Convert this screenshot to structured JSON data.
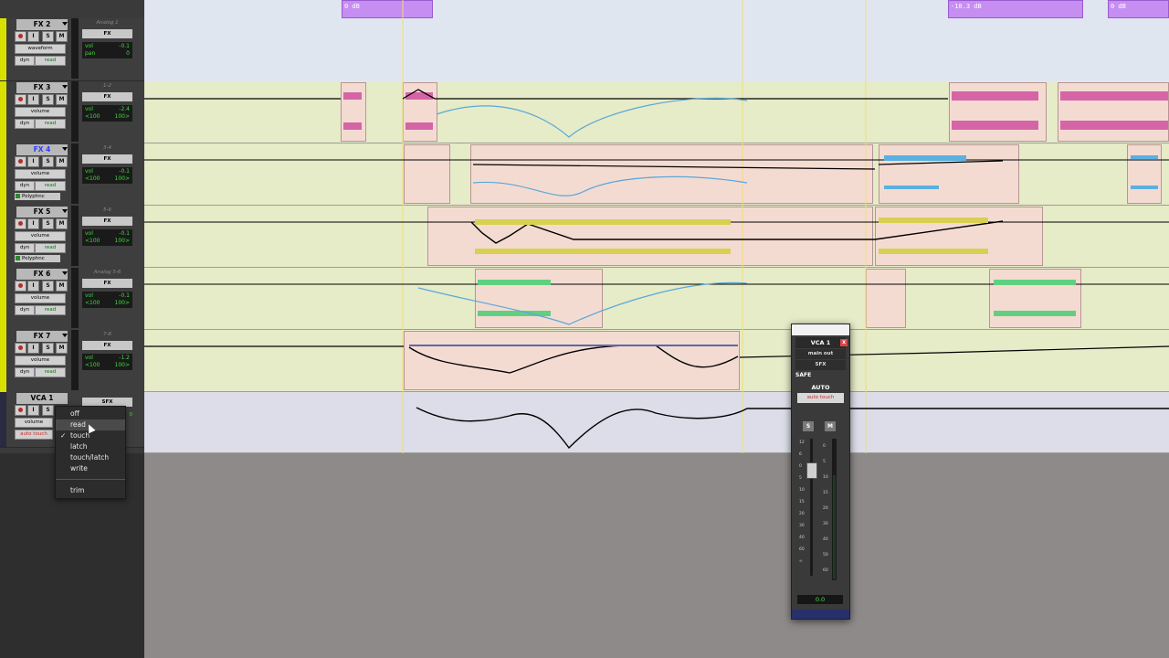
{
  "tracks": [
    {
      "name": "FX 2",
      "input": "Analog 1",
      "output": "FX",
      "view": "waveform",
      "automation": "read",
      "vol": "-0.1",
      "pan": "0",
      "vol_label": "vol",
      "pan_label": "pan",
      "selected": false,
      "plugin": ""
    },
    {
      "name": "FX 3",
      "input": "1-2",
      "output": "FX",
      "view": "volume",
      "automation": "read",
      "vol": "-2.4",
      "pan_l": "<100",
      "pan_r": "100>",
      "vol_label": "vol",
      "selected": false,
      "plugin": ""
    },
    {
      "name": "FX 4",
      "input": "3-4",
      "output": "FX",
      "view": "volume",
      "automation": "read",
      "vol": "-0.1",
      "pan_l": "<100",
      "pan_r": "100>",
      "vol_label": "vol",
      "selected": true,
      "plugin": "Polyphnc"
    },
    {
      "name": "FX 5",
      "input": "5-6",
      "output": "FX",
      "view": "volume",
      "automation": "read",
      "vol": "-0.1",
      "pan_l": "<100",
      "pan_r": "100>",
      "vol_label": "vol",
      "selected": false,
      "plugin": "Polyphnc"
    },
    {
      "name": "FX 6",
      "input": "Analog 5-6",
      "output": "FX",
      "view": "volume",
      "automation": "read",
      "vol": "-0.1",
      "pan_l": "<100",
      "pan_r": "100>",
      "vol_label": "vol",
      "selected": false,
      "plugin": ""
    },
    {
      "name": "FX 7",
      "input": "7-8",
      "output": "FX",
      "view": "volume",
      "automation": "read",
      "vol": "-1.2",
      "pan_l": "<100",
      "pan_r": "100>",
      "vol_label": "vol",
      "selected": false,
      "plugin": ""
    }
  ],
  "vca_track": {
    "name": "VCA 1",
    "output": "SFX",
    "view": "volume",
    "automation": "auto touch",
    "value": "0"
  },
  "buttons": {
    "input": "I",
    "solo": "S",
    "mute": "M",
    "dyn": "dyn"
  },
  "clips": {
    "fx2_1": "0 dB",
    "fx2_2": "-10.3 dB",
    "fx2_3": "0 dB"
  },
  "automation_menu": {
    "items": [
      "off",
      "read",
      "touch",
      "latch",
      "touch/latch",
      "write"
    ],
    "trim": "trim",
    "checked": "touch",
    "highlighted": "read",
    "check_glyph": "✓"
  },
  "vca_window": {
    "title": "VCA 1",
    "close": "x",
    "output": "main out",
    "group": "SFX",
    "safe": "SAFE",
    "auto_label": "AUTO",
    "auto_mode": "auto touch",
    "solo": "S",
    "mute": "M",
    "scale_left": [
      "12",
      "6",
      "0",
      "5",
      "10",
      "15",
      "20",
      "30",
      "40",
      "60",
      "∞"
    ],
    "scale_right": [
      "0",
      "5",
      "10",
      "15",
      "20",
      "30",
      "40",
      "50",
      "60"
    ],
    "readout": "0.0",
    "fader_level_db": 0.0
  },
  "colors": {
    "track_color": "#d8e000",
    "fx2_clip": "#c58ef0",
    "lane": "#e6ebc8",
    "vol_text": "#3cdc3c",
    "auto_red": "#c82c2c"
  }
}
